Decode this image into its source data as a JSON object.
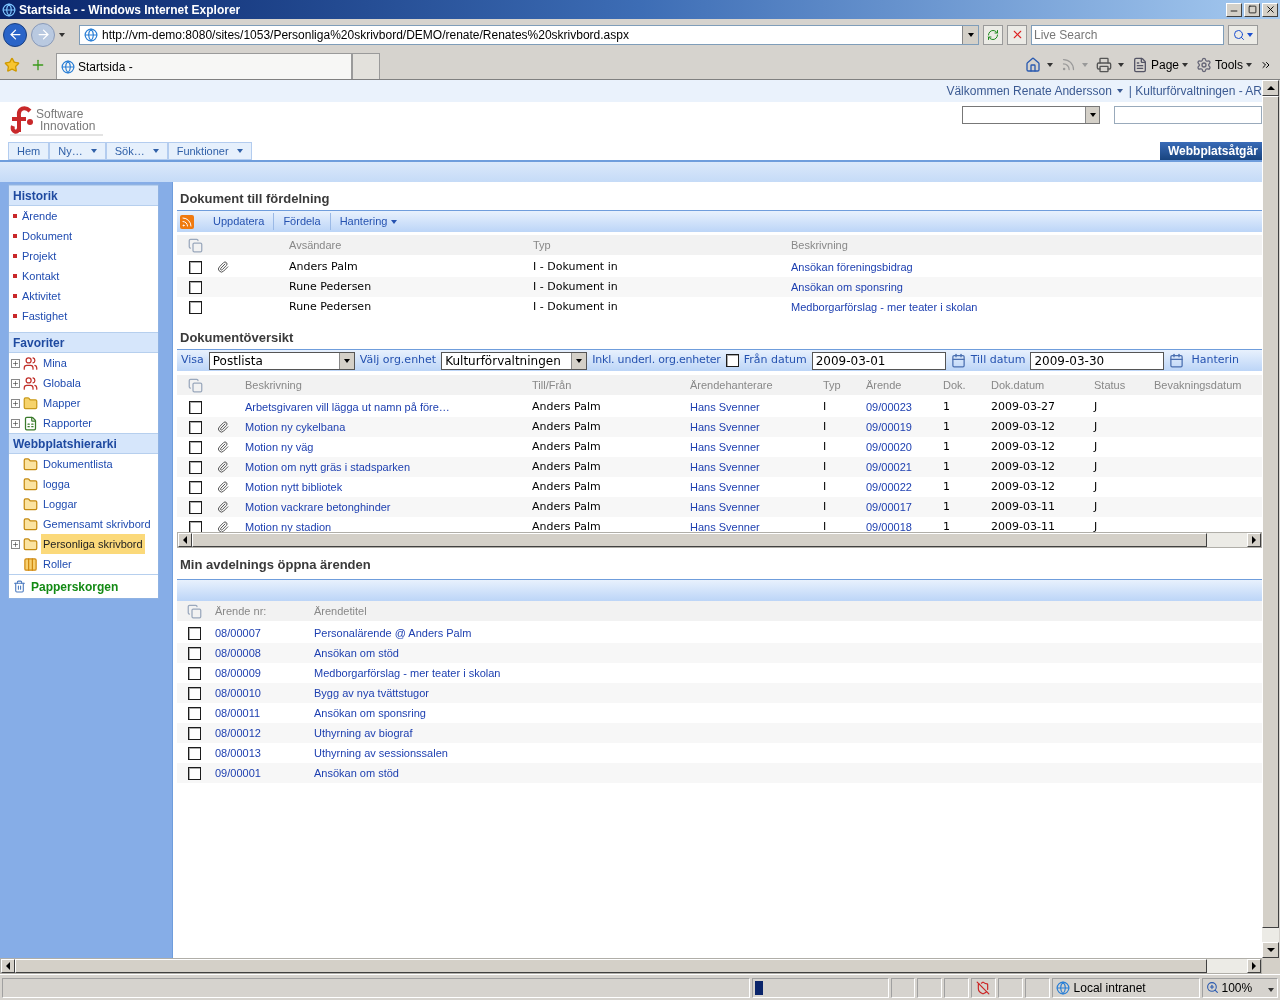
{
  "browser": {
    "title": "Startsida - - Windows Internet Explorer",
    "url": "http://vm-demo:8080/sites/1053/Personliga%20skrivbord/DEMO/renate/Renates%20skrivbord.aspx",
    "search_placeholder": "Live Search",
    "tab": "Startsida -",
    "commands": [
      {
        "label": "Page"
      },
      {
        "label": "Tools"
      }
    ]
  },
  "header": {
    "welcome": "Välkommen Renate Andersson",
    "org": "| Kulturförvaltningen - AR",
    "logo": [
      "Software",
      "Innovation"
    ],
    "nav": [
      {
        "label": "Hem",
        "menu": false
      },
      {
        "label": "Ny…",
        "menu": true
      },
      {
        "label": "Sök…",
        "menu": true
      },
      {
        "label": "Funktioner",
        "menu": true
      }
    ],
    "site_actions": "Webbplatsåtgär"
  },
  "sidebar": {
    "sections": [
      {
        "title": "Historik",
        "kind": "links",
        "items": [
          {
            "label": "Ärende"
          },
          {
            "label": "Dokument"
          },
          {
            "label": "Projekt"
          },
          {
            "label": "Kontakt"
          },
          {
            "label": "Aktivitet"
          },
          {
            "label": "Fastighet"
          }
        ]
      },
      {
        "title": "Favoriter",
        "kind": "tree",
        "items": [
          {
            "label": "Mina",
            "kind": "group",
            "expandable": true,
            "selected": false
          },
          {
            "label": "Globala",
            "kind": "group",
            "expandable": true,
            "selected": false
          },
          {
            "label": "Mapper",
            "kind": "folder",
            "expandable": true,
            "selected": false
          },
          {
            "label": "Rapporter",
            "kind": "report",
            "expandable": true,
            "selected": false
          }
        ]
      },
      {
        "title": "Webbplatshierarki",
        "kind": "tree",
        "items": [
          {
            "label": "Dokumentlista",
            "kind": "site",
            "expandable": false,
            "selected": false
          },
          {
            "label": "logga",
            "kind": "site",
            "expandable": false,
            "selected": false
          },
          {
            "label": "Loggar",
            "kind": "site",
            "expandable": false,
            "selected": false
          },
          {
            "label": "Gemensamt skrivbord",
            "kind": "site",
            "expandable": false,
            "selected": false
          },
          {
            "label": "Personliga skrivbord",
            "kind": "site",
            "expandable": true,
            "selected": true
          },
          {
            "label": "Roller",
            "kind": "list",
            "expandable": false,
            "selected": false
          }
        ]
      }
    ],
    "recycle_bin": "Papperskorgen"
  },
  "distribution": {
    "title": "Dokument till fördelning",
    "actions": [
      {
        "label": "Uppdatera",
        "menu": false
      },
      {
        "label": "Fördela",
        "menu": false
      },
      {
        "label": "Hantering",
        "menu": true
      }
    ],
    "columns": [
      "Avsändare",
      "Typ",
      "Beskrivning"
    ],
    "rows": [
      {
        "checked": false,
        "attachment": true,
        "sender": "Anders Palm",
        "type": "I - Dokument in",
        "description": "Ansökan föreningsbidrag"
      },
      {
        "checked": false,
        "attachment": false,
        "sender": "Rune Pedersen",
        "type": "I - Dokument in",
        "description": "Ansökan om sponsring"
      },
      {
        "checked": false,
        "attachment": false,
        "sender": "Rune Pedersen",
        "type": "I - Dokument in",
        "description": "Medborgarförslag - mer teater i skolan"
      }
    ]
  },
  "overview": {
    "title": "Dokumentöversikt",
    "filters": {
      "view_label": "Visa",
      "view_value": "Postlista",
      "org_label": "Välj org.enhet",
      "org_value": "Kulturförvaltningen",
      "include_label": "Inkl. underl. org.enheter",
      "include_checked": false,
      "from_label": "Från datum",
      "from_value": "2009-03-01",
      "to_label": "Till datum",
      "to_value": "2009-03-30",
      "action": "Hanterin"
    },
    "columns": [
      "Beskrivning",
      "Till/Från",
      "Ärendehanterare",
      "Typ",
      "Ärende",
      "Dok.",
      "Dok.datum",
      "Status",
      "Bevakningsdatum"
    ],
    "rows": [
      {
        "checked": false,
        "attachment": false,
        "description": "Arbetsgivaren vill lägga ut namn på före…",
        "party": "Anders Palm",
        "handler": "Hans Svenner",
        "type": "I",
        "case": "09/00023",
        "docs": "1",
        "date": "2009-03-27",
        "status": "J"
      },
      {
        "checked": false,
        "attachment": true,
        "description": "Motion ny cykelbana",
        "party": "Anders Palm",
        "handler": "Hans Svenner",
        "type": "I",
        "case": "09/00019",
        "docs": "1",
        "date": "2009-03-12",
        "status": "J"
      },
      {
        "checked": false,
        "attachment": true,
        "description": "Motion ny väg",
        "party": "Anders Palm",
        "handler": "Hans Svenner",
        "type": "I",
        "case": "09/00020",
        "docs": "1",
        "date": "2009-03-12",
        "status": "J"
      },
      {
        "checked": false,
        "attachment": true,
        "description": "Motion om nytt gräs i stadsparken",
        "party": "Anders Palm",
        "handler": "Hans Svenner",
        "type": "I",
        "case": "09/00021",
        "docs": "1",
        "date": "2009-03-12",
        "status": "J"
      },
      {
        "checked": false,
        "attachment": true,
        "description": "Motion nytt bibliotek",
        "party": "Anders Palm",
        "handler": "Hans Svenner",
        "type": "I",
        "case": "09/00022",
        "docs": "1",
        "date": "2009-03-12",
        "status": "J"
      },
      {
        "checked": false,
        "attachment": true,
        "description": "Motion vackrare betonghinder",
        "party": "Anders Palm",
        "handler": "Hans Svenner",
        "type": "I",
        "case": "09/00017",
        "docs": "1",
        "date": "2009-03-11",
        "status": "J"
      },
      {
        "checked": false,
        "attachment": true,
        "description": "Motion ny stadion",
        "party": "Anders Palm",
        "handler": "Hans Svenner",
        "type": "I",
        "case": "09/00018",
        "docs": "1",
        "date": "2009-03-11",
        "status": "J"
      }
    ]
  },
  "open_cases": {
    "title": "Min avdelnings öppna ärenden",
    "columns": [
      "Ärende nr:",
      "Ärendetitel"
    ],
    "rows": [
      {
        "checked": false,
        "number": "08/00007",
        "title": "Personalärende @ Anders Palm"
      },
      {
        "checked": false,
        "number": "08/00008",
        "title": "Ansökan om stöd"
      },
      {
        "checked": false,
        "number": "08/00009",
        "title": "Medborgarförslag - mer teater i skolan"
      },
      {
        "checked": false,
        "number": "08/00010",
        "title": "Bygg av nya tvättstugor"
      },
      {
        "checked": false,
        "number": "08/00011",
        "title": "Ansökan om sponsring"
      },
      {
        "checked": false,
        "number": "08/00012",
        "title": "Uthyrning av biograf"
      },
      {
        "checked": false,
        "number": "08/00013",
        "title": "Uthyrning av sessionssalen"
      },
      {
        "checked": false,
        "number": "09/00001",
        "title": "Ansökan om stöd"
      }
    ]
  },
  "status_bar": {
    "progress": {
      "level": 0.06
    },
    "zone": "Local intranet",
    "zoom": "100%"
  }
}
